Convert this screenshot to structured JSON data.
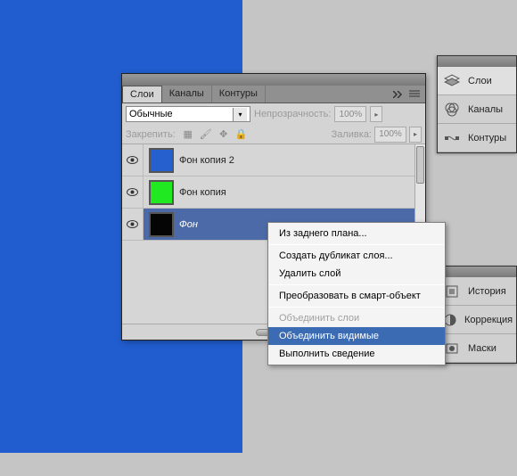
{
  "tabs": {
    "layers": "Слои",
    "channels": "Каналы",
    "paths": "Контуры"
  },
  "blend": {
    "value": "Обычные"
  },
  "opacity": {
    "label": "Непрозрачность:",
    "value": "100%"
  },
  "lock": {
    "label": "Закрепить:"
  },
  "fill": {
    "label": "Заливка:",
    "value": "100%"
  },
  "layers": [
    {
      "name": "Фон копия 2",
      "color": "#2660ce",
      "selected": false
    },
    {
      "name": "Фон копия",
      "color": "#21e921",
      "selected": false
    },
    {
      "name": "Фон",
      "color": "#050505",
      "selected": true
    }
  ],
  "ctx": {
    "from_bg": "Из заднего плана...",
    "dup": "Создать дубликат слоя...",
    "del": "Удалить слой",
    "smart": "Преобразовать в смарт-объект",
    "merge": "Объединить слои",
    "merge_vis": "Объединить видимые",
    "flatten": "Выполнить сведение"
  },
  "dock1": {
    "layers": "Слои",
    "channels": "Каналы",
    "paths": "Контуры"
  },
  "dock2": {
    "history": "История",
    "correction": "Коррекция",
    "masks": "Маски"
  }
}
